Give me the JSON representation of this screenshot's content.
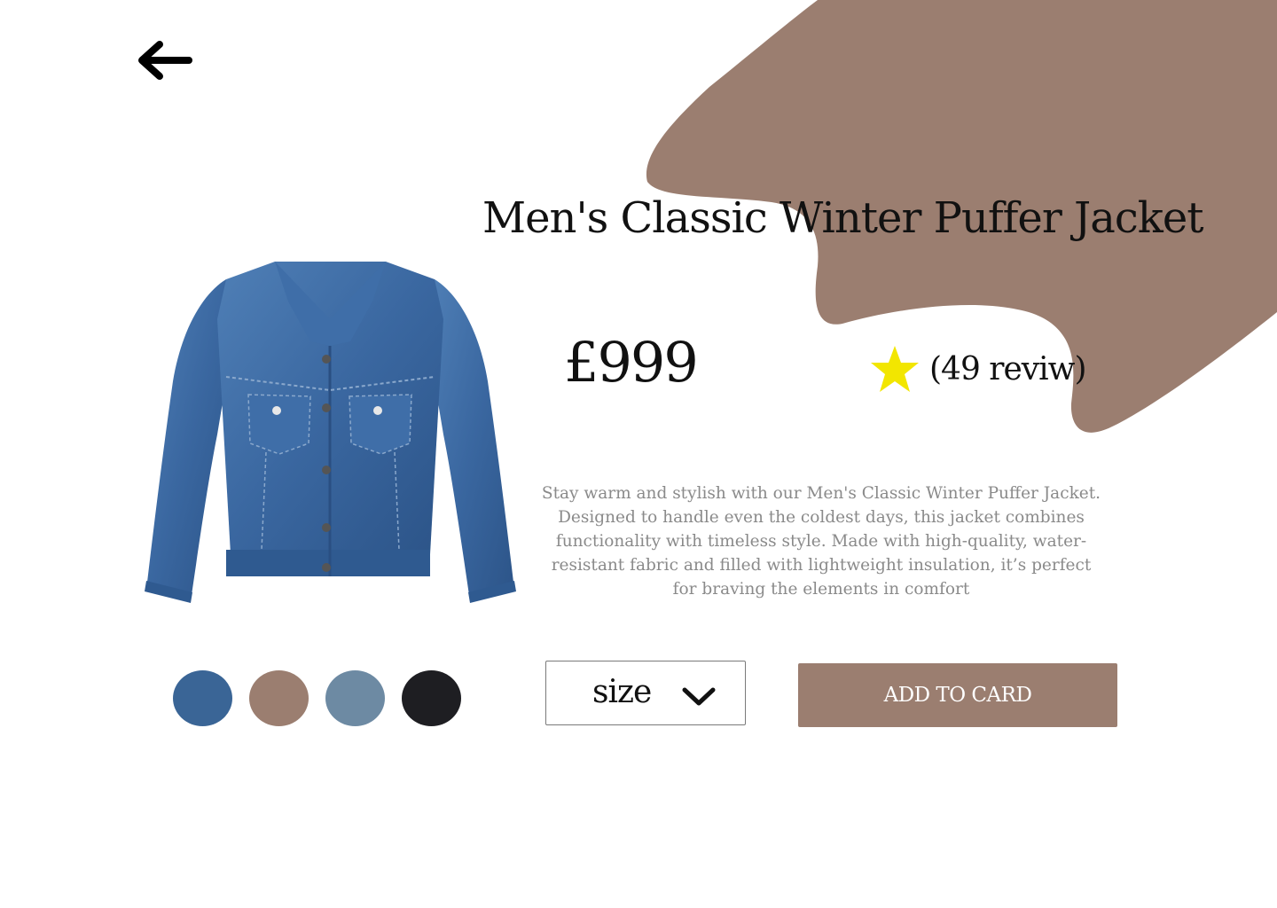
{
  "colors": {
    "accent": "#9b7e70",
    "text": "#111111",
    "muted_text": "#8a8a8a",
    "star": "#f2e600"
  },
  "nav": {
    "back_icon": "arrow-left-icon"
  },
  "product": {
    "title": "Men's Classic Winter Puffer Jacket",
    "image_icon": "denim-jacket-image",
    "price": "£999",
    "rating_icon": "star-icon",
    "review_text": "(49 reviw)",
    "description": "Stay warm and stylish with our Men's Classic Winter Puffer Jacket. Designed to handle even the coldest days, this jacket combines functionality with timeless style. Made with high-quality, water-resistant fabric and filled with lightweight insulation, it’s perfect for braving the elements in comfort"
  },
  "swatches": [
    {
      "color": "#3a6596"
    },
    {
      "color": "#9b7e70"
    },
    {
      "color": "#6d8aa3"
    },
    {
      "color": "#1e1e22"
    }
  ],
  "size_select": {
    "label": "size",
    "icon": "chevron-down-icon"
  },
  "actions": {
    "add_label": "ADD TO CARD"
  }
}
